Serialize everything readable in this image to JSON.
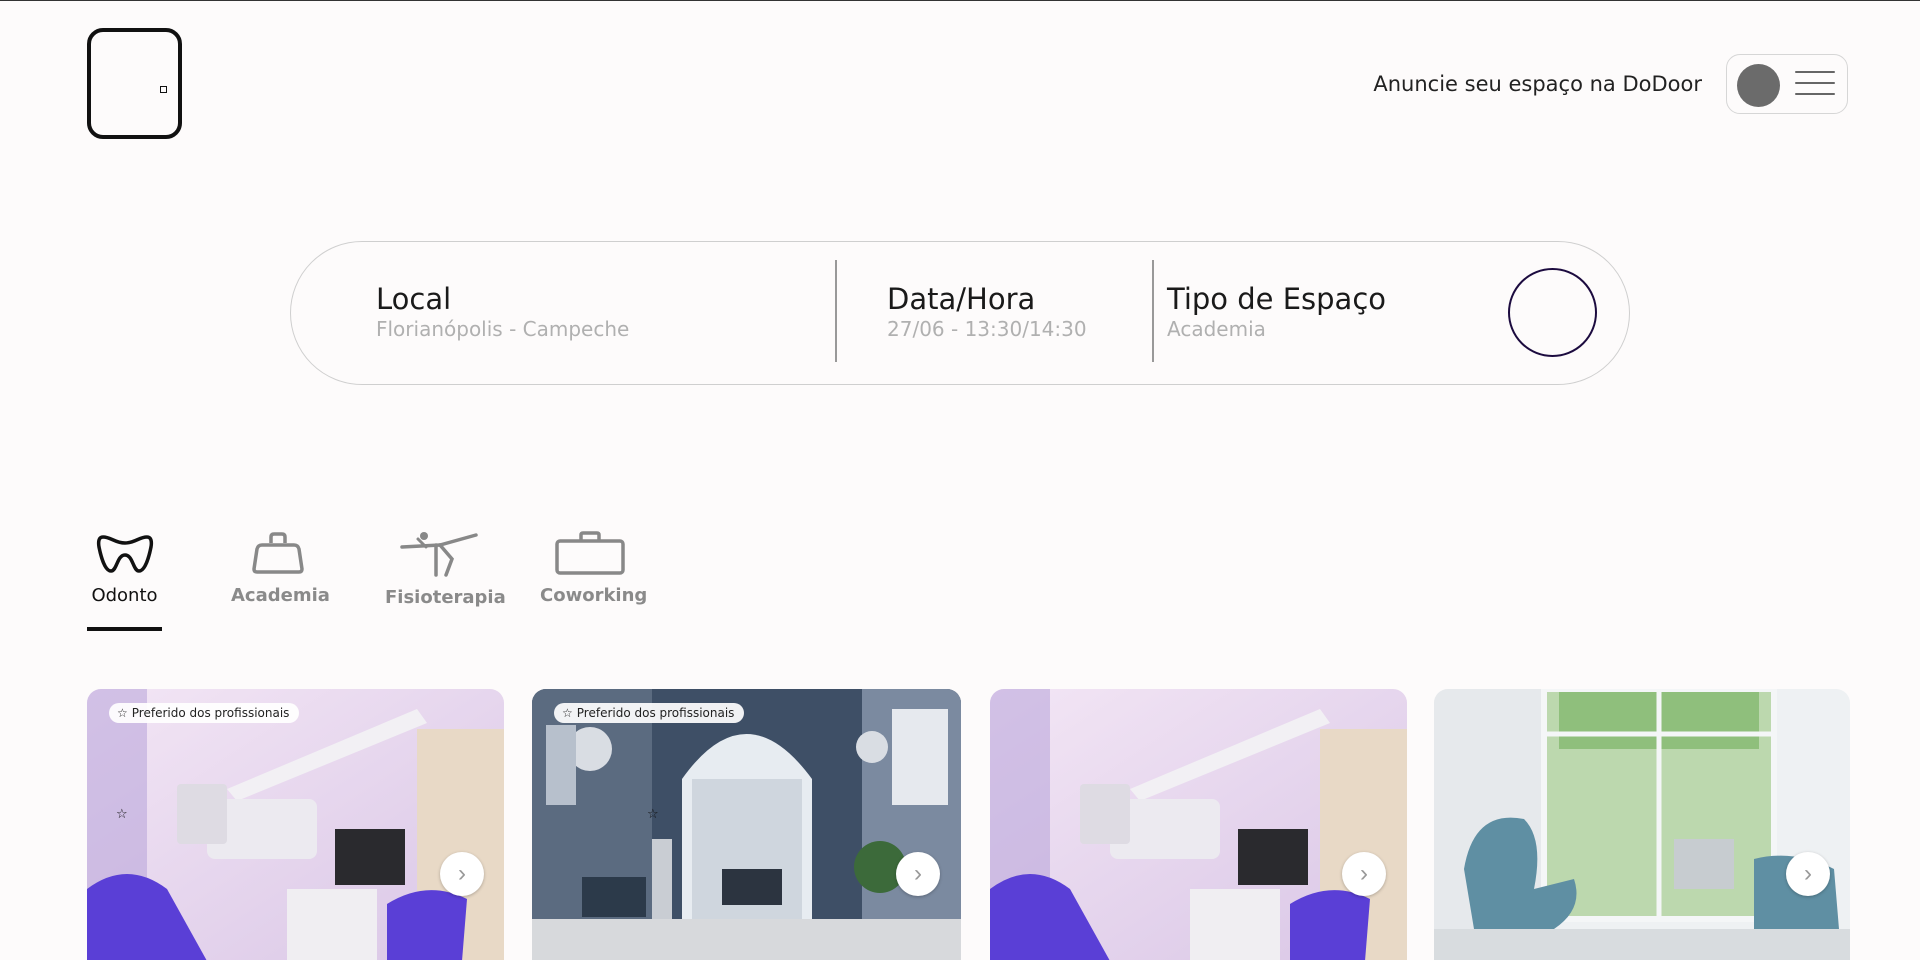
{
  "header": {
    "announce_label": "Anuncie seu espaço na DoDoor"
  },
  "search": {
    "local_label": "Local",
    "local_value": "Florianópolis - Campeche",
    "date_label": "Data/Hora",
    "date_value": "27/06 - 13:30/14:30",
    "type_label": "Tipo de Espaço",
    "type_value": "Academia"
  },
  "categories": [
    {
      "label": "Odonto",
      "icon": "tooth-icon",
      "active": true
    },
    {
      "label": "Academia",
      "icon": "kettlebell-icon",
      "active": false
    },
    {
      "label": "Fisioterapia",
      "icon": "stretching-icon",
      "active": false
    },
    {
      "label": "Coworking",
      "icon": "briefcase-icon",
      "active": false
    }
  ],
  "cards": [
    {
      "badge": "Preferido dos profissionais",
      "image": "dental-office-purple"
    },
    {
      "badge": "Preferido dos profissionais",
      "image": "physio-clinic-blue"
    },
    {
      "badge": "",
      "image": "dental-office-purple"
    },
    {
      "badge": "",
      "image": "dental-office-window"
    }
  ],
  "colors": {
    "accent": "#1c0b3f",
    "background": "#fdfbfb",
    "muted_text": "#b0b0b0"
  }
}
